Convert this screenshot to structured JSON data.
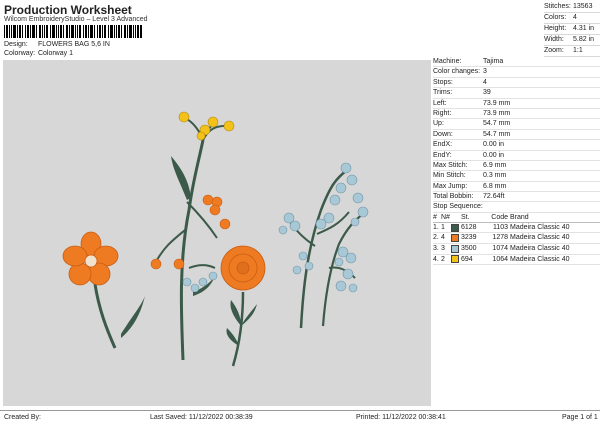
{
  "header": {
    "title": "Production Worksheet",
    "subtitle": "Wilcom EmbroideryStudio – Level 3 Advanced",
    "design_label": "Design:",
    "design_value": "FLOWERS BAG 5,6 IN",
    "colorway_label": "Colorway:",
    "colorway_value": "Colorway 1"
  },
  "topstats": [
    {
      "k": "Stitches:",
      "v": "13563"
    },
    {
      "k": "Colors:",
      "v": "4"
    },
    {
      "k": "Height:",
      "v": "4.31 in"
    },
    {
      "k": "Width:",
      "v": "5.82 in"
    },
    {
      "k": "Zoom:",
      "v": "1:1"
    }
  ],
  "details": [
    {
      "k": "Machine:",
      "v": "Tajima"
    },
    {
      "k": "Color changes:",
      "v": "3"
    },
    {
      "k": "Stops:",
      "v": "4"
    },
    {
      "k": "Trims:",
      "v": "39"
    },
    {
      "k": "Left:",
      "v": "73.9 mm"
    },
    {
      "k": "Right:",
      "v": "73.9 mm"
    },
    {
      "k": "Up:",
      "v": "54.7 mm"
    },
    {
      "k": "Down:",
      "v": "54.7 mm"
    },
    {
      "k": "EndX:",
      "v": "0.00 in"
    },
    {
      "k": "EndY:",
      "v": "0.00 in"
    },
    {
      "k": "Max Stitch:",
      "v": "6.9 mm"
    },
    {
      "k": "Min Stitch:",
      "v": "0.3 mm"
    },
    {
      "k": "Max Jump:",
      "v": "6.8 mm"
    },
    {
      "k": "Total Bobbin:",
      "v": "72.64ft"
    }
  ],
  "sequence": {
    "title": "Stop Sequence:",
    "headers": [
      "#",
      "N#",
      "",
      "St.",
      "Code",
      "Brand"
    ],
    "rows": [
      {
        "n": "1.",
        "nn": "1",
        "color": "#3b5a4a",
        "st": "6128",
        "code": "1103",
        "brand": "Madeira Classic 40"
      },
      {
        "n": "2.",
        "nn": "4",
        "color": "#ee7a22",
        "st": "3239",
        "code": "1278",
        "brand": "Madeira Classic 40"
      },
      {
        "n": "3.",
        "nn": "3",
        "color": "#a8c8d6",
        "st": "3500",
        "code": "1074",
        "brand": "Madeira Classic 40"
      },
      {
        "n": "4.",
        "nn": "2",
        "color": "#f2c21a",
        "st": "694",
        "code": "1064",
        "brand": "Madeira Classic 40"
      }
    ]
  },
  "footer": {
    "created": "Created By:",
    "saved": "Last Saved: 11/12/2022 00:38:39",
    "printed": "Printed: 11/12/2022 00:38:41",
    "page": "Page 1 of 1"
  },
  "colors": {
    "stem": "#3b5a4a",
    "orange": "#ee7a22",
    "blue": "#a8c8d6",
    "yellow": "#f2c21a",
    "canvas_bg": "#d7d7d7"
  }
}
